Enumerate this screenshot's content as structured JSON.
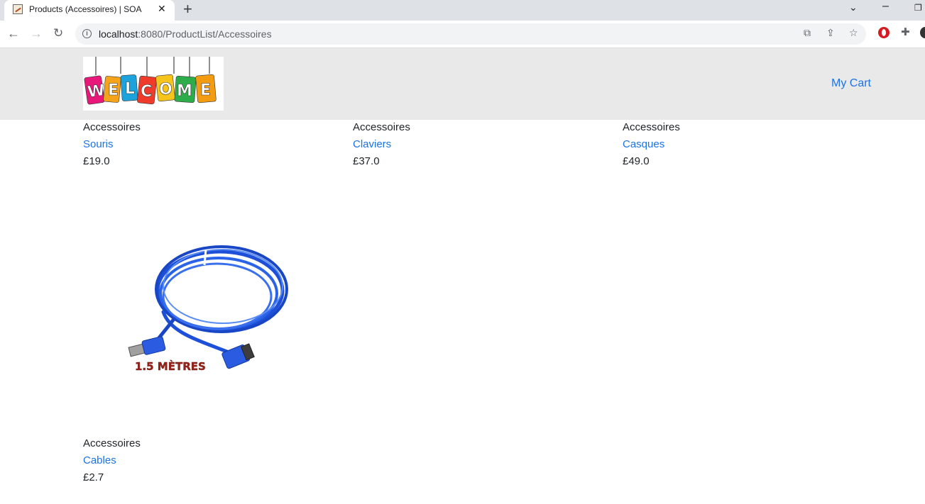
{
  "browser": {
    "tab_title": "Products (Accessoires) | SOA",
    "url_host": "localhost",
    "url_rest": ":8080/ProductList/Accessoires"
  },
  "header": {
    "logo_text": "WELCOME",
    "cart_link": "My Cart"
  },
  "products": [
    {
      "category": "Accessoires",
      "name": "Souris",
      "price": "£19.0"
    },
    {
      "category": "Accessoires",
      "name": "Claviers",
      "price": "£37.0"
    },
    {
      "category": "Accessoires",
      "name": "Casques",
      "price": "£49.0"
    },
    {
      "category": "Accessoires",
      "name": "Cables",
      "price": "£2.7",
      "image_caption": "1.5 MÈTRES"
    }
  ],
  "colors": {
    "link": "#1a73e8",
    "header_bg": "#e9e9e9",
    "cable_blue": "#1d4fd8",
    "caption_red": "#9b2218"
  }
}
